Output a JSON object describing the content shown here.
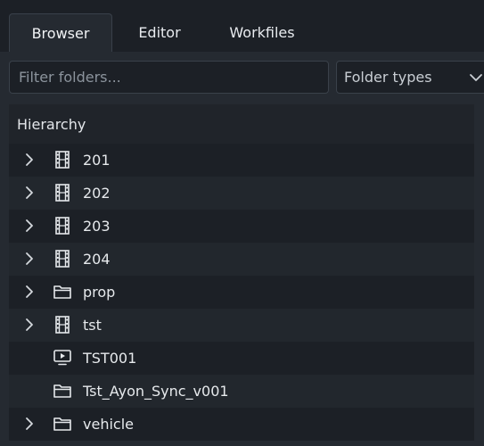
{
  "tabs": [
    {
      "label": "Browser",
      "active": true
    },
    {
      "label": "Editor",
      "active": false
    },
    {
      "label": "Workfiles",
      "active": false
    }
  ],
  "filter": {
    "placeholder": "Filter folders...",
    "value": "",
    "folder_types_label": "Folder types"
  },
  "tree": {
    "header": "Hierarchy",
    "rows": [
      {
        "label": "201",
        "icon": "film-icon",
        "expandable": true
      },
      {
        "label": "202",
        "icon": "film-icon",
        "expandable": true
      },
      {
        "label": "203",
        "icon": "film-icon",
        "expandable": true
      },
      {
        "label": "204",
        "icon": "film-icon",
        "expandable": true
      },
      {
        "label": "prop",
        "icon": "folder-icon",
        "expandable": true
      },
      {
        "label": "tst",
        "icon": "film-icon",
        "expandable": true
      },
      {
        "label": "TST001",
        "icon": "monitor-play-icon",
        "expandable": false
      },
      {
        "label": "Tst_Ayon_Sync_v001",
        "icon": "folder-icon",
        "expandable": false
      },
      {
        "label": "vehicle",
        "icon": "folder-icon",
        "expandable": true
      }
    ]
  },
  "colors": {
    "background": "#1c2026",
    "panel": "#252a31",
    "row_alt": "#22272d",
    "text": "#e6e9ec"
  }
}
